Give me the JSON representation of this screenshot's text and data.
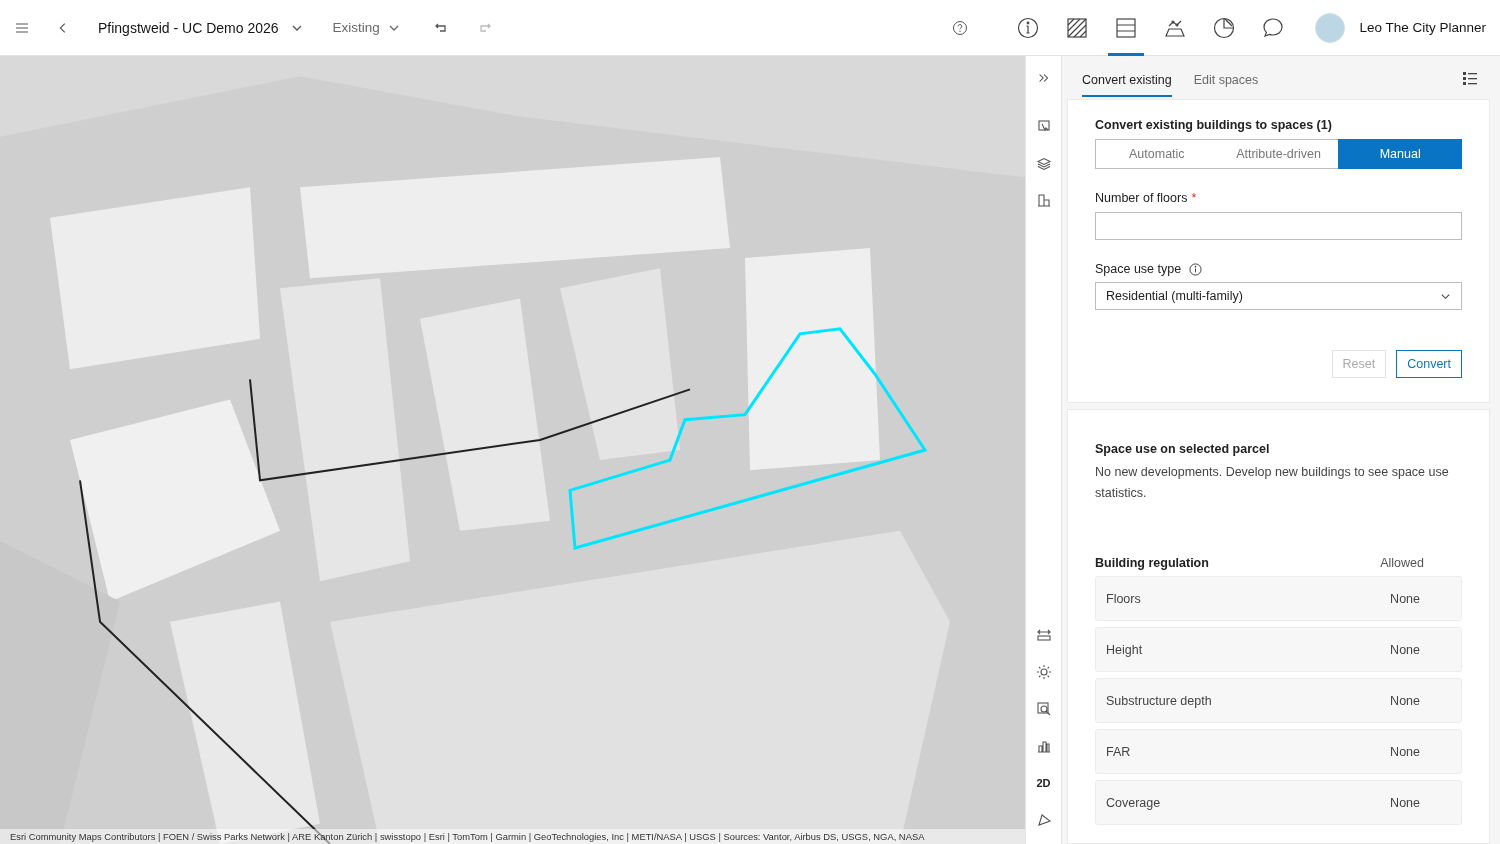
{
  "header": {
    "title": "Pfingstweid - UC Demo 2026",
    "mode": "Existing"
  },
  "toolbar": [
    {
      "kind": "info",
      "selected": false
    },
    {
      "kind": "hatch",
      "selected": false
    },
    {
      "kind": "table",
      "selected": true
    },
    {
      "kind": "terrain",
      "selected": false
    },
    {
      "kind": "pie",
      "selected": false
    },
    {
      "kind": "chat",
      "selected": false
    }
  ],
  "user": {
    "name": "Leo The City Planner"
  },
  "side_tools_top": [
    {
      "kind": "select"
    },
    {
      "kind": "layers"
    },
    {
      "kind": "buildings"
    }
  ],
  "side_tools_bottom": [
    {
      "kind": "measure"
    },
    {
      "kind": "sun"
    },
    {
      "kind": "zoom"
    },
    {
      "kind": "chart"
    },
    {
      "kind": "text",
      "label": "2D"
    },
    {
      "kind": "navigate"
    }
  ],
  "panel": {
    "tabs": [
      {
        "label": "Convert existing",
        "selected": true
      },
      {
        "label": "Edit spaces",
        "selected": false
      }
    ],
    "convert": {
      "heading": "Convert existing buildings to spaces (1)",
      "modes": [
        {
          "label": "Automatic",
          "selected": false
        },
        {
          "label": "Attribute-driven",
          "selected": false
        },
        {
          "label": "Manual",
          "selected": true
        }
      ],
      "floors_label": "Number of floors",
      "required_mark": "*",
      "space_use_label": "Space use type",
      "space_use_value": "Residential (multi-family)",
      "buttons": [
        {
          "label": "Reset",
          "disabled": true
        },
        {
          "label": "Convert",
          "disabled": false
        }
      ]
    },
    "space_use": {
      "heading": "Space use on selected parcel",
      "message": "No new developments. Develop new buildings to see space use statistics."
    },
    "regulation": {
      "heading": "Building regulation",
      "column": "Allowed",
      "rows": [
        {
          "name": "Floors",
          "value": "None"
        },
        {
          "name": "Height",
          "value": "None"
        },
        {
          "name": "Substructure depth",
          "value": "None"
        },
        {
          "name": "FAR",
          "value": "None"
        },
        {
          "name": "Coverage",
          "value": "None"
        }
      ]
    }
  },
  "attribution": "Esri Community Maps Contributors | FOEN / Swiss Parks Network | ARE Kanton Zürich | swisstopo | Esri | TomTom | Garmin | GeoTechnologies, Inc | METI/NASA | USGS | Sources: Vantor, Airbus DS, USGS, NGA, NASA"
}
